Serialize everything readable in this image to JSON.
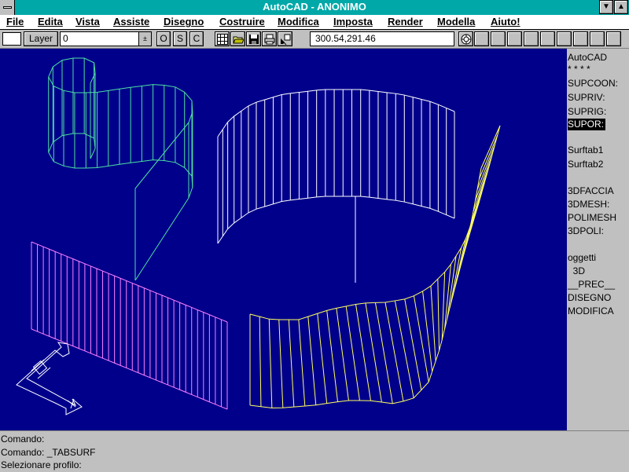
{
  "window": {
    "title": "AutoCAD - ANONIMO",
    "minimize_glyph": "▼",
    "maximize_glyph": "▲"
  },
  "menu": {
    "items": [
      "File",
      "Edita",
      "Vista",
      "Assiste",
      "Disegno",
      "Costruire",
      "Modifica",
      "Imposta",
      "Render",
      "Modella",
      "Aiuto!"
    ]
  },
  "toolbar": {
    "layer_label": "Layer",
    "layer_value": "0",
    "ortho_label": "O",
    "snap_label": "S",
    "coords_label": "C",
    "coordinates": "300.54,291.46",
    "dropdown_glyph": "±"
  },
  "side_menu": {
    "items": [
      "AutoCAD",
      "* * * *",
      "SUPCOON:",
      "SUPRIV:",
      "SUPRIG:",
      "SUPOR:",
      "",
      "Surftab1",
      "Surftab2",
      "",
      "3DFACCIA",
      "3DMESH:",
      "POLIMESH",
      "3DPOLI:",
      "",
      "oggetti",
      "  3D",
      "__PREC__",
      "DISEGNO",
      "MODIFICA"
    ],
    "selected": "SUPOR:"
  },
  "command": {
    "lines": [
      "Comando:",
      "Comando: _TABSURF",
      "Selezionare profilo:"
    ]
  },
  "colors": {
    "titlebar": "#00a8a8",
    "canvas": "#00008b",
    "chrome": "#c0c0c0",
    "cyan_surface": "#4ee0a0",
    "magenta_surface": "#ff80ff",
    "white_surface": "#ffffff",
    "yellow_surface": "#ffff60"
  },
  "icons": [
    "grid-icon",
    "open-folder-icon",
    "save-disk-icon",
    "print-icon",
    "pointer-icon",
    "aerial-view-icon"
  ]
}
